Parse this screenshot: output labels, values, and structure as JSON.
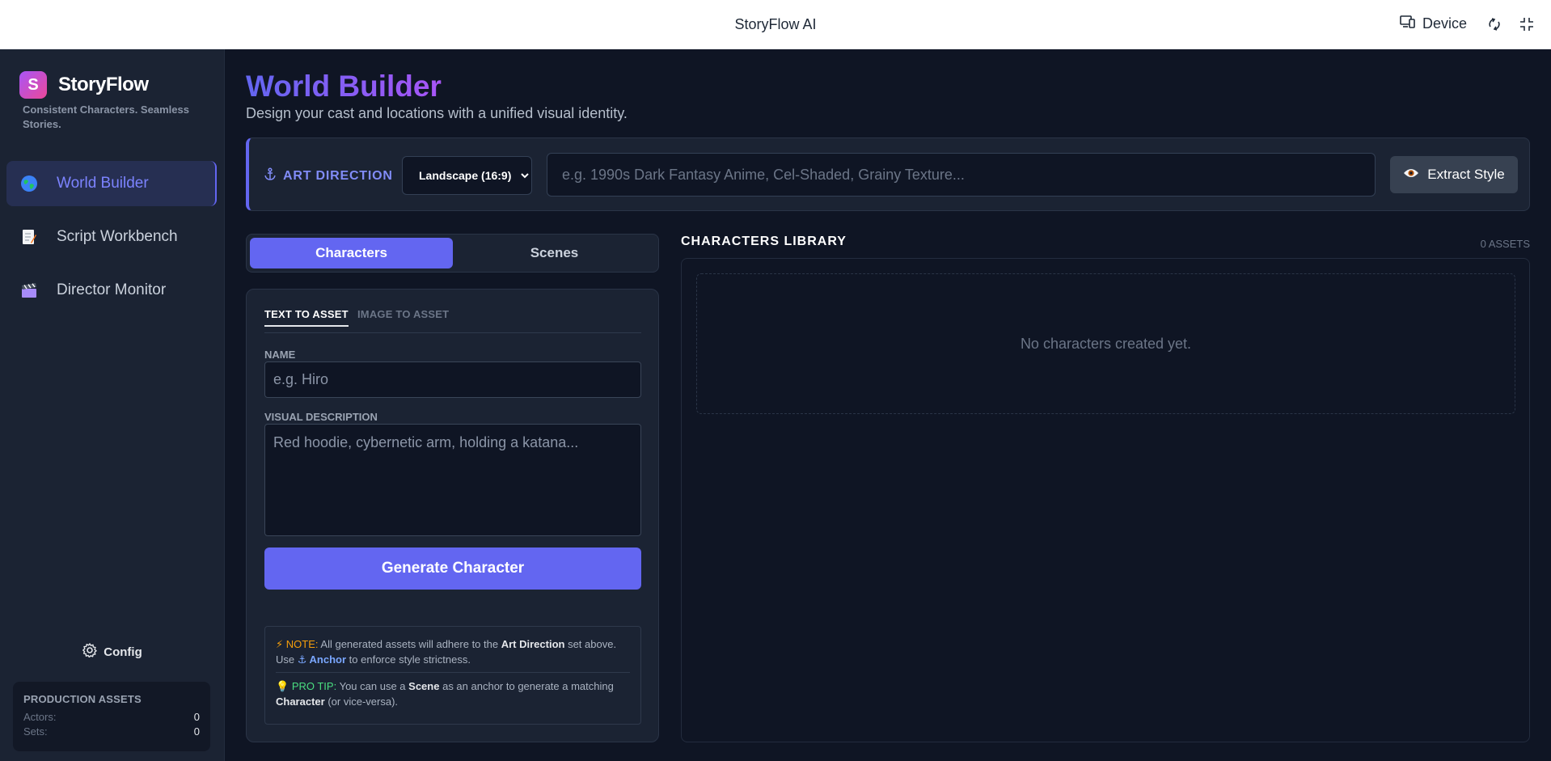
{
  "topbar": {
    "title": "StoryFlow AI",
    "device_label": "Device"
  },
  "sidebar": {
    "logo_letter": "S",
    "brand": "StoryFlow",
    "tagline": "Consistent Characters. Seamless Stories.",
    "items": [
      {
        "label": "World Builder",
        "icon": "globe-icon",
        "active": true
      },
      {
        "label": "Script Workbench",
        "icon": "memo-icon",
        "active": false
      },
      {
        "label": "Director Monitor",
        "icon": "clapper-icon",
        "active": false
      }
    ],
    "config_label": "Config",
    "production": {
      "title": "PRODUCTION ASSETS",
      "actors_label": "Actors:",
      "actors_value": "0",
      "sets_label": "Sets:",
      "sets_value": "0"
    }
  },
  "main": {
    "title": "World Builder",
    "subtitle": "Design your cast and locations with a unified visual identity.",
    "art_direction": {
      "label": "ART DIRECTION",
      "aspect_selected": "Landscape (16:9)",
      "style_placeholder": "e.g. 1990s Dark Fantasy Anime, Cel-Shaded, Grainy Texture...",
      "extract_label": "Extract Style"
    },
    "tabs": [
      {
        "label": "Characters",
        "active": true
      },
      {
        "label": "Scenes",
        "active": false
      }
    ],
    "form": {
      "subtabs": [
        {
          "label": "TEXT TO ASSET",
          "active": true
        },
        {
          "label": "IMAGE TO ASSET",
          "active": false
        }
      ],
      "name_label": "NAME",
      "name_placeholder": "e.g. Hiro",
      "desc_label": "VISUAL DESCRIPTION",
      "desc_placeholder": "Red hoodie, cybernetic arm, holding a katana...",
      "generate_label": "Generate Character",
      "note": {
        "note_key": "NOTE:",
        "note_text_1": "All generated assets will adhere to the",
        "note_bold": "Art Direction",
        "note_text_2": "set above.",
        "use_text": "Use",
        "anchor_label": "Anchor",
        "anchor_text": "to enforce style strictness.",
        "tip_key": "PRO TIP:",
        "tip_text_1": "You can use a",
        "tip_scene": "Scene",
        "tip_text_2": "as an anchor to generate a matching",
        "tip_character": "Character",
        "tip_text_3": "(or vice-versa)."
      }
    },
    "library": {
      "title": "CHARACTERS LIBRARY",
      "count": "0 ASSETS",
      "empty_text": "No characters created yet."
    }
  },
  "colors": {
    "accent": "#6366f1",
    "background": "#0f1524",
    "panel": "#1b2333"
  }
}
